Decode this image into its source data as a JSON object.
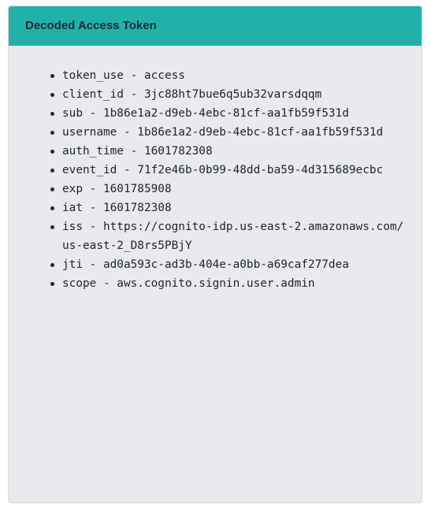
{
  "card": {
    "title": "Decoded Access Token"
  },
  "claims": [
    "token_use - access",
    "client_id - 3jc88ht7bue6q5ub32varsdqqm",
    "sub - 1b86e1a2-d9eb-4ebc-81cf-aa1fb59f531d",
    "username - 1b86e1a2-d9eb-4ebc-81cf-aa1fb59f531d",
    "auth_time - 1601782308",
    "event_id - 71f2e46b-0b99-48dd-ba59-4d315689ecbc",
    "exp - 1601785908",
    "iat - 1601782308",
    "iss - https://cognito-idp.us-east-2.amazonaws.com/us-east-2_D8rs5PBjY",
    "jti - ad0a593c-ad3b-404e-a0bb-a69caf277dea",
    "scope - aws.cognito.signin.user.admin"
  ],
  "colors": {
    "header_bg": "#20b2aa",
    "body_bg": "#e8eaed",
    "text": "#1f2328"
  }
}
